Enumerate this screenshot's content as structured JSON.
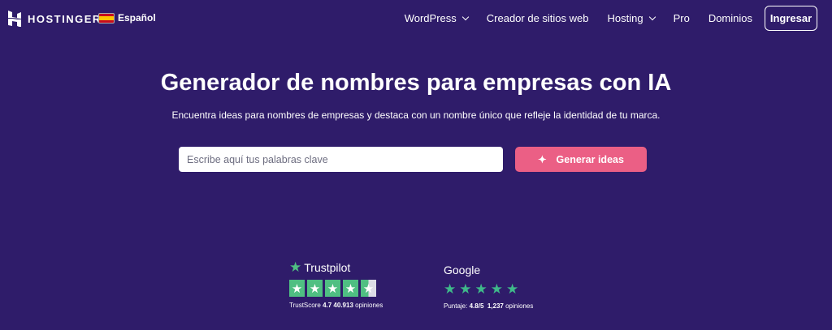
{
  "nav": {
    "brand": "HOSTINGER",
    "language": "Español",
    "items": [
      "WordPress",
      "Creador de sitios web",
      "Hosting",
      "Pro",
      "Dominios"
    ],
    "login": "Ingresar"
  },
  "hero": {
    "title": "Generador de nombres para empresas con IA",
    "subtitle": "Encuentra ideas para nombres de empresas y destaca con un nombre único que refleje la identidad de tu marca.",
    "placeholder": "Escribe aquí tus palabras clave",
    "button": "Generar ideas"
  },
  "trustpilot": {
    "name": "Trustpilot",
    "score_label": "TrustScore",
    "score": "4.7",
    "count": "40.913",
    "count_label": "opiniones",
    "rating": 4.5
  },
  "google": {
    "name": "Google",
    "score_label": "Puntaje:",
    "score": "4.8/5",
    "count": "1,237",
    "count_label": "opiniones",
    "rating": 5
  },
  "colors": {
    "background": "#2f1c6a",
    "accent": "#eb5f85",
    "trustpilot": "#4fbf82"
  }
}
